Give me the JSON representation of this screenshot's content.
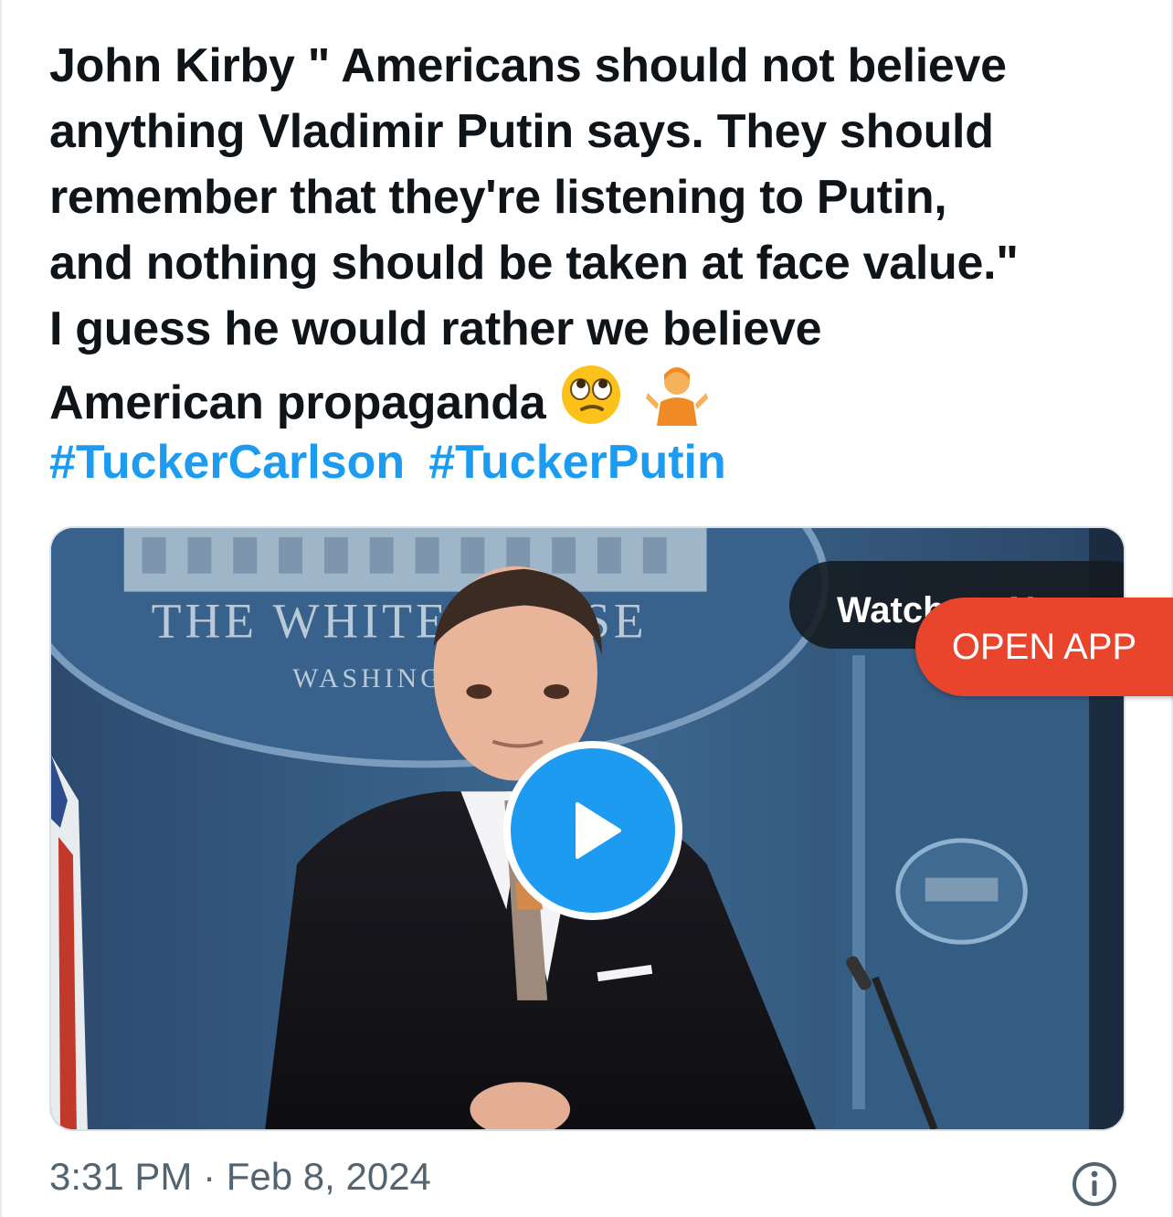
{
  "tweet": {
    "text_lines": [
      "John Kirby \" Americans should not believe",
      "anything Vladimir Putin says.  They should",
      "remember that they're listening to Putin,",
      "and nothing should be taken at face value.\"",
      "I guess he would rather we believe",
      "American propaganda"
    ],
    "emojis": [
      "face-with-rolling-eyes-icon",
      "person-shrugging-icon"
    ],
    "hashtags": [
      "#TuckerCarlson",
      "#TuckerPutin"
    ]
  },
  "media": {
    "watch_label": "Watch on X",
    "backdrop_text_primary": "THE WHITE HOUSE",
    "backdrop_text_secondary": "WASHINGTON",
    "play_icon": "play-icon"
  },
  "banner": {
    "open_app_label": "OPEN APP"
  },
  "footer": {
    "timestamp": "3:31 PM · Feb 8, 2024",
    "info_icon": "info-icon"
  },
  "colors": {
    "link": "#1d9bf0",
    "text": "#0f1419",
    "muted": "#536471",
    "open_app": "#e8452c",
    "play": "#1d9bf0"
  }
}
